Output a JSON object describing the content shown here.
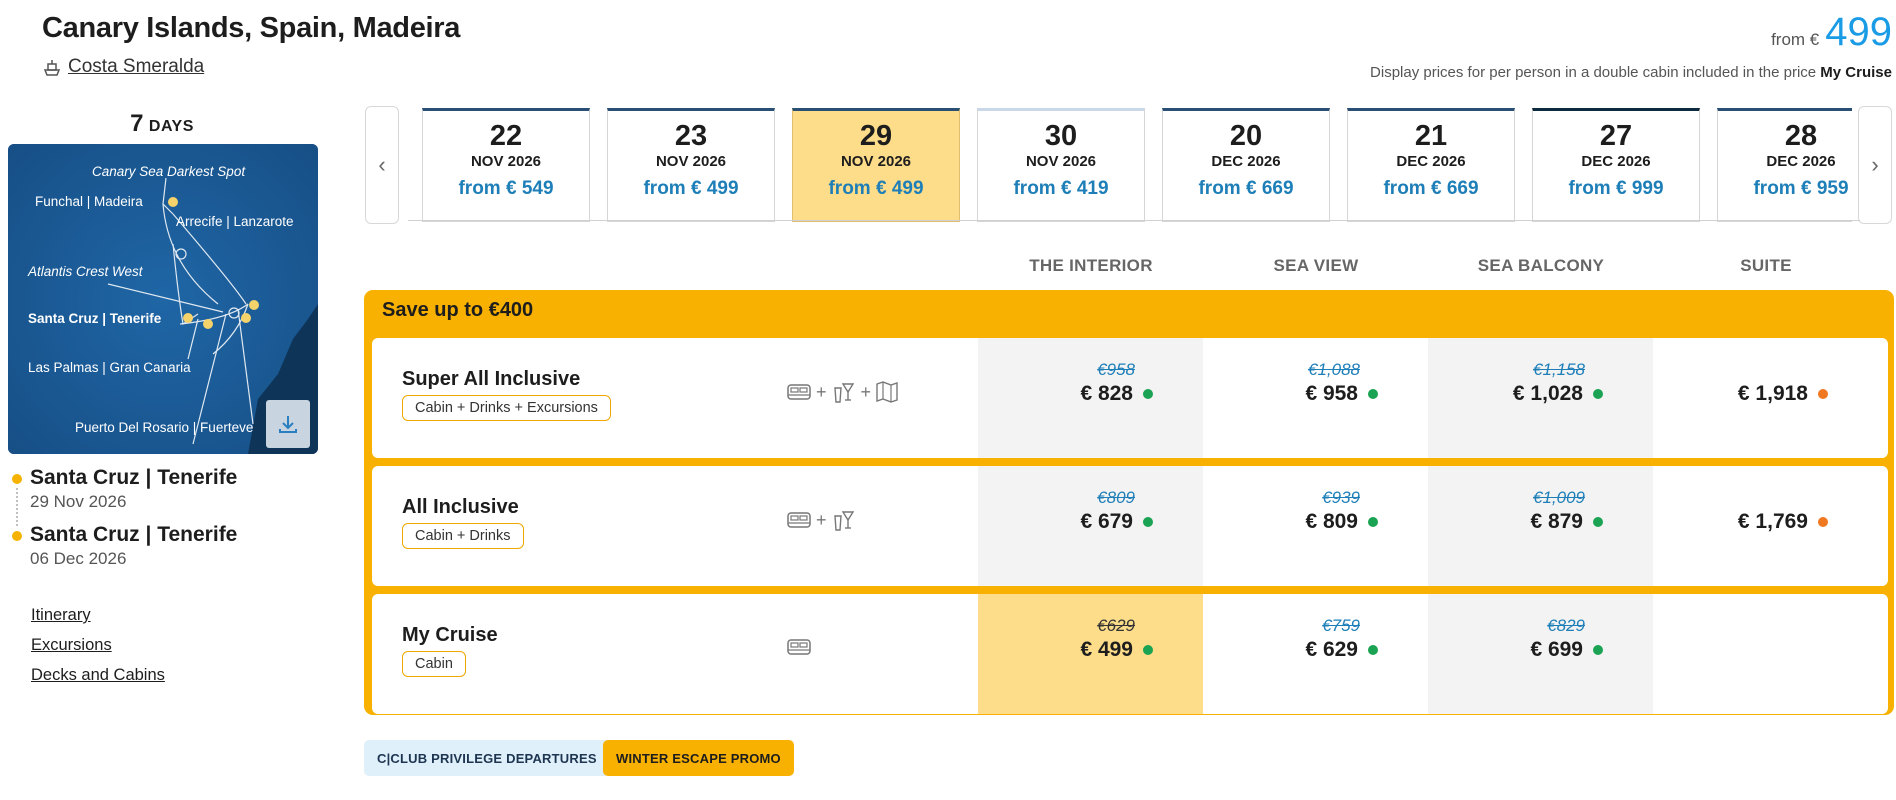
{
  "header": {
    "title": "Canary Islands, Spain, Madeira",
    "ship_name": "Costa Smeralda",
    "price_from_label": "from €",
    "price_from_value": "499",
    "price_note_prefix": "Display prices for per person in a double cabin included in the price",
    "price_note_plan": "My Cruise"
  },
  "sidebar": {
    "days_number": "7",
    "days_label": "DAYS",
    "map_labels": {
      "spot": "Canary Sea Darkest Spot",
      "funchal": "Funchal | Madeira",
      "arrecife": "Arrecife | Lanzarote",
      "atlantis": "Atlantis Crest West",
      "santa_cruz": "Santa Cruz | Tenerife",
      "las_palmas": "Las Palmas | Gran Canaria",
      "puerto": "Puerto Del Rosario | Fuerteve"
    },
    "stops": [
      {
        "port": "Santa Cruz | Tenerife",
        "date": "29 Nov 2026"
      },
      {
        "port": "Santa Cruz | Tenerife",
        "date": "06 Dec 2026"
      }
    ],
    "links": [
      "Itinerary",
      "Excursions",
      "Decks and Cabins"
    ]
  },
  "dates": [
    {
      "day": "22",
      "month": "NOV 2026",
      "price": "from € 549"
    },
    {
      "day": "23",
      "month": "NOV 2026",
      "price": "from € 499"
    },
    {
      "day": "29",
      "month": "NOV 2026",
      "price": "from € 499",
      "selected": true
    },
    {
      "day": "30",
      "month": "NOV 2026",
      "price": "from € 419"
    },
    {
      "day": "20",
      "month": "DEC 2026",
      "price": "from € 669"
    },
    {
      "day": "21",
      "month": "DEC 2026",
      "price": "from € 669"
    },
    {
      "day": "27",
      "month": "DEC 2026",
      "price": "from € 999"
    },
    {
      "day": "28",
      "month": "DEC 2026",
      "price": "from € 959"
    }
  ],
  "columns": [
    "THE INTERIOR",
    "SEA VIEW",
    "SEA BALCONY",
    "SUITE"
  ],
  "promo": {
    "title": "Save up to €400"
  },
  "packages": [
    {
      "name": "Super All Inclusive",
      "tag": "Cabin + Drinks + Excursions",
      "prices": [
        {
          "old": "€958",
          "new": "€ 828",
          "status": "green"
        },
        {
          "old": "€1,088",
          "new": "€ 958",
          "status": "green"
        },
        {
          "old": "€1,158",
          "new": "€ 1,028",
          "status": "green"
        },
        {
          "old": "",
          "new": "€ 1,918",
          "status": "orange"
        }
      ]
    },
    {
      "name": "All Inclusive",
      "tag": "Cabin + Drinks",
      "prices": [
        {
          "old": "€809",
          "new": "€ 679",
          "status": "green"
        },
        {
          "old": "€939",
          "new": "€ 809",
          "status": "green"
        },
        {
          "old": "€1,009",
          "new": "€ 879",
          "status": "green"
        },
        {
          "old": "",
          "new": "€ 1,769",
          "status": "orange"
        }
      ]
    },
    {
      "name": "My Cruise",
      "tag": "Cabin",
      "prices": [
        {
          "old": "€629",
          "new": "€ 499",
          "status": "green"
        },
        {
          "old": "€759",
          "new": "€ 629",
          "status": "green"
        },
        {
          "old": "€829",
          "new": "€ 699",
          "status": "green"
        },
        {
          "old": "",
          "new": "",
          "status": ""
        }
      ]
    }
  ],
  "badges": {
    "club": "C|CLUB PRIVILEGE DEPARTURES",
    "winter": "WINTER ESCAPE PROMO"
  },
  "colors": {
    "accent_blue": "#1a9be6",
    "promo_yellow": "#f8b100",
    "selected_date": "#fddc8a",
    "status_green": "#1aa352",
    "status_orange": "#f07820"
  }
}
